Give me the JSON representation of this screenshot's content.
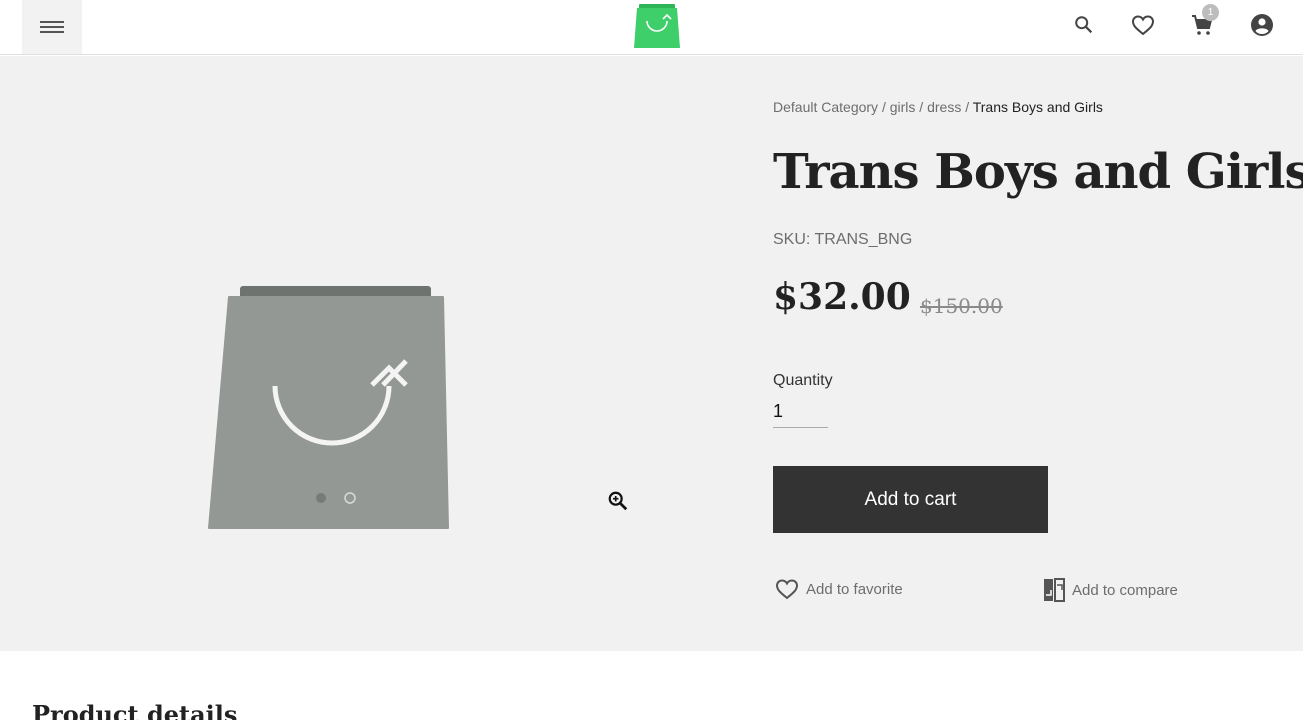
{
  "header": {
    "menu_icon": "hamburger-menu-icon",
    "logo_icon": "shopping-bag-logo",
    "brand_color": "#3ecf6b",
    "search_icon": "search-icon",
    "wishlist_icon": "heart-outline-icon",
    "cart_icon": "cart-icon",
    "cart_count": "1",
    "account_icon": "account-circle-icon"
  },
  "breadcrumb": {
    "items": [
      "Default Category",
      "girls",
      "dress"
    ],
    "separator": "/",
    "current": "Trans Boys and Girls"
  },
  "product": {
    "title": "Trans Boys and Girls",
    "sku": "SKU: TRANS_BNG",
    "price": "$32.00",
    "old_price": "$150.00",
    "quantity_label": "Quantity",
    "quantity_value": "1",
    "add_to_cart_label": "Add to cart",
    "add_to_favorite_label": "Add to favorite",
    "add_to_compare_label": "Add to compare",
    "image_placeholder_color": "#949894",
    "image_count": 2,
    "active_image": 1
  },
  "details": {
    "title": "Product details"
  }
}
